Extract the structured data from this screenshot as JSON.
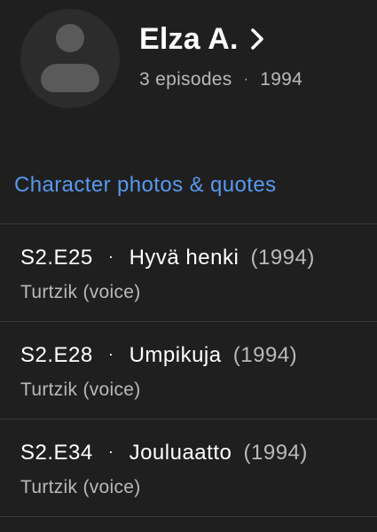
{
  "header": {
    "name": "Elza A.",
    "episodes": "3 episodes",
    "separator": "·",
    "year": "1994"
  },
  "photos_link": "Character photos & quotes",
  "episodes": [
    {
      "code": "S2.E25",
      "sep": "·",
      "title": "Hyvä henki",
      "year": "(1994)",
      "role": "Turtzik (voice)"
    },
    {
      "code": "S2.E28",
      "sep": "·",
      "title": "Umpikuja",
      "year": "(1994)",
      "role": "Turtzik (voice)"
    },
    {
      "code": "S2.E34",
      "sep": "·",
      "title": "Jouluaatto",
      "year": "(1994)",
      "role": "Turtzik (voice)"
    }
  ],
  "colors": {
    "background": "#1f1f1f",
    "link": "#5799ef",
    "muted": "#b9b9b9"
  },
  "icons": [
    "avatar-placeholder-icon",
    "chevron-right-icon"
  ]
}
